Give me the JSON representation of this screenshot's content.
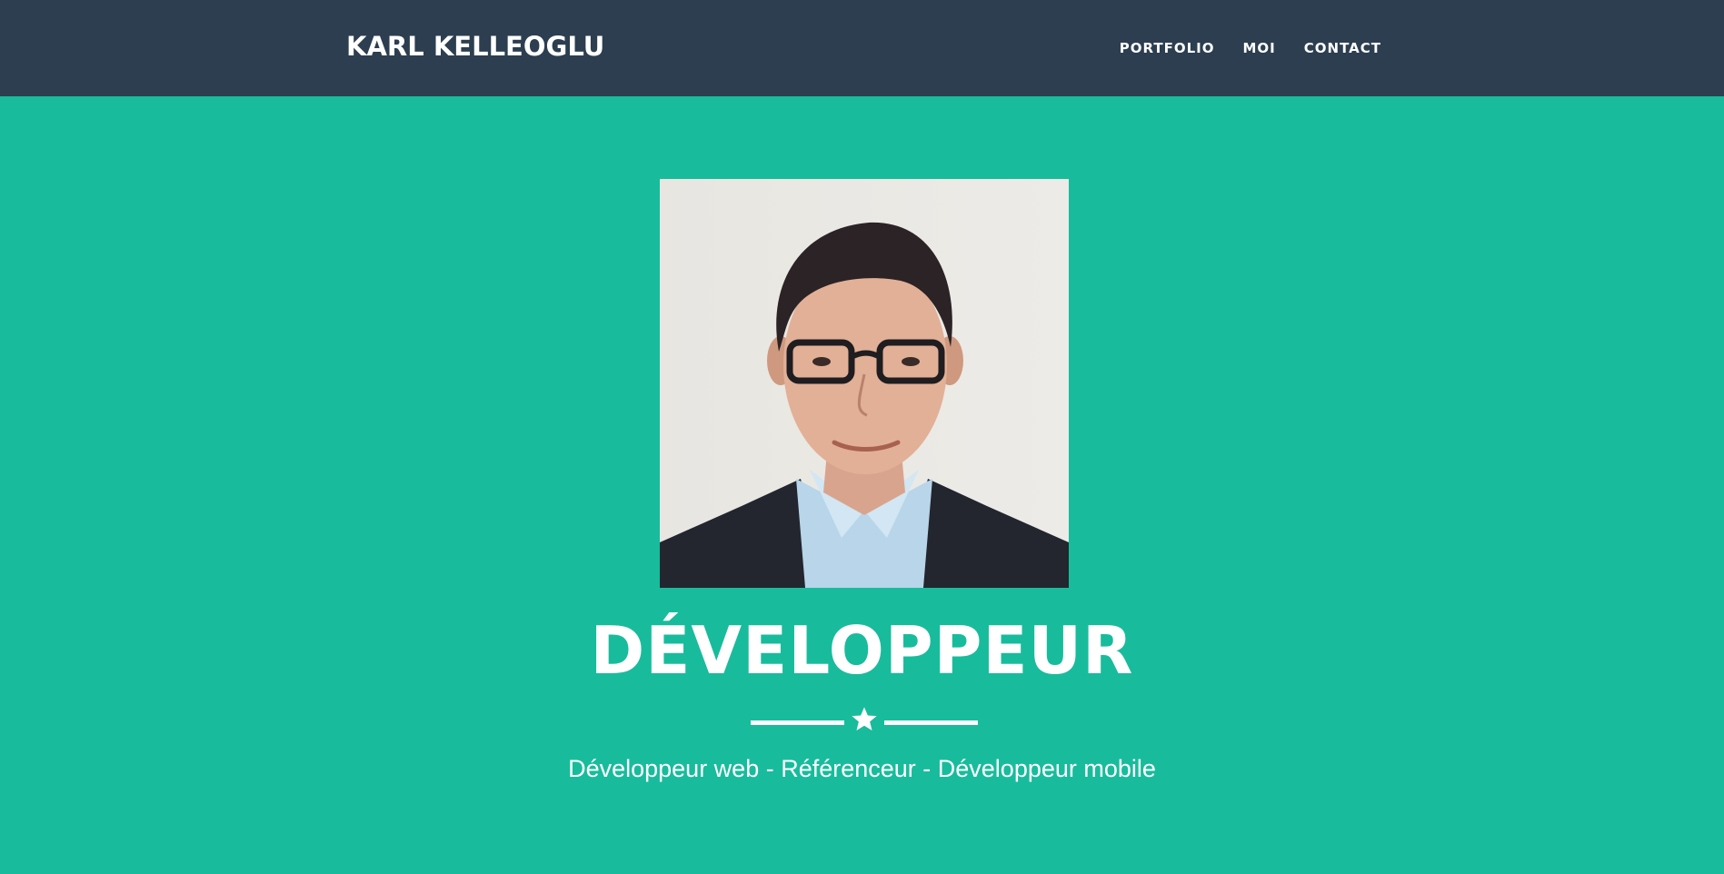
{
  "header": {
    "brand": "KARL KELLEOGLU",
    "nav": [
      {
        "label": "PORTFOLIO"
      },
      {
        "label": "MOI"
      },
      {
        "label": "CONTACT"
      }
    ]
  },
  "hero": {
    "photo_alt": "profile-photo",
    "title": "DÉVELOPPEUR",
    "divider_icon": "star-icon",
    "subtitle": "Développeur web - Référenceur - Développeur mobile"
  },
  "colors": {
    "navbar": "#2c3e50",
    "hero": "#18bc9c",
    "text": "#ffffff"
  }
}
